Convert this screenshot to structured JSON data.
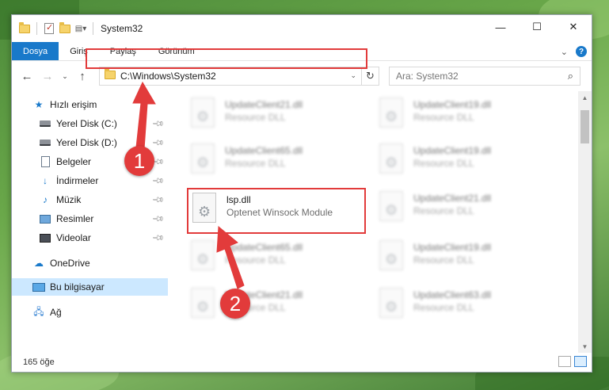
{
  "window": {
    "title": "System32",
    "controls": {
      "minimize": "—",
      "maximize": "☐",
      "close": "✕"
    }
  },
  "ribbon": {
    "tabs": [
      "Dosya",
      "Giriş",
      "Paylaş",
      "Görünüm"
    ],
    "expand_glyph": "⌄",
    "help_glyph": "?"
  },
  "nav": {
    "back": "←",
    "forward": "→",
    "recent": "⌄",
    "up": "↑",
    "address": "C:\\Windows\\System32",
    "refresh": "↻",
    "search_placeholder": "Ara: System32"
  },
  "sidebar": {
    "items": [
      {
        "label": "Hızlı erişim",
        "icon": "star-icon"
      },
      {
        "label": "Yerel Disk (C:)",
        "icon": "drive-icon",
        "pinned": true
      },
      {
        "label": "Yerel Disk (D:)",
        "icon": "drive-icon",
        "pinned": true
      },
      {
        "label": "Belgeler",
        "icon": "document-icon",
        "pinned": true
      },
      {
        "label": "İndirmeler",
        "icon": "download-icon",
        "pinned": true
      },
      {
        "label": "Müzik",
        "icon": "music-icon",
        "pinned": true
      },
      {
        "label": "Resimler",
        "icon": "pictures-icon",
        "pinned": true
      },
      {
        "label": "Videolar",
        "icon": "videos-icon",
        "pinned": true
      },
      {
        "label": "OneDrive",
        "icon": "cloud-icon"
      },
      {
        "label": "Bu bilgisayar",
        "icon": "computer-icon",
        "selected": true
      },
      {
        "label": "Ağ",
        "icon": "network-icon"
      }
    ]
  },
  "files": [
    {
      "name": "UpdateClient21.dll",
      "desc": "Resource DLL",
      "blurred": true
    },
    {
      "name": "UpdateClient19.dll",
      "desc": "Resource DLL",
      "blurred": true
    },
    {
      "name": "UpdateClient65.dll",
      "desc": "Resource DLL",
      "blurred": true
    },
    {
      "name": "UpdateClient19.dll",
      "desc": "Resource DLL",
      "blurred": true
    },
    {
      "name": "lsp.dll",
      "desc": "Optenet Winsock Module",
      "blurred": false,
      "highlighted": true
    },
    {
      "name": "UpdateClient21.dll",
      "desc": "Resource DLL",
      "blurred": true
    },
    {
      "name": "UpdateClient65.dll",
      "desc": "Resource DLL",
      "blurred": true
    },
    {
      "name": "UpdateClient19.dll",
      "desc": "Resource DLL",
      "blurred": true
    },
    {
      "name": "UpdateClient21.dll",
      "desc": "Resource DLL",
      "blurred": true
    },
    {
      "name": "UpdateClient63.dll",
      "desc": "Resource DLL",
      "blurred": true
    }
  ],
  "status": {
    "count": "165 öğe"
  },
  "annotations": {
    "step1": "1",
    "step2": "2"
  },
  "colors": {
    "accent": "#1979ca",
    "annotation": "#e23b3b",
    "selection": "#cce8ff"
  }
}
